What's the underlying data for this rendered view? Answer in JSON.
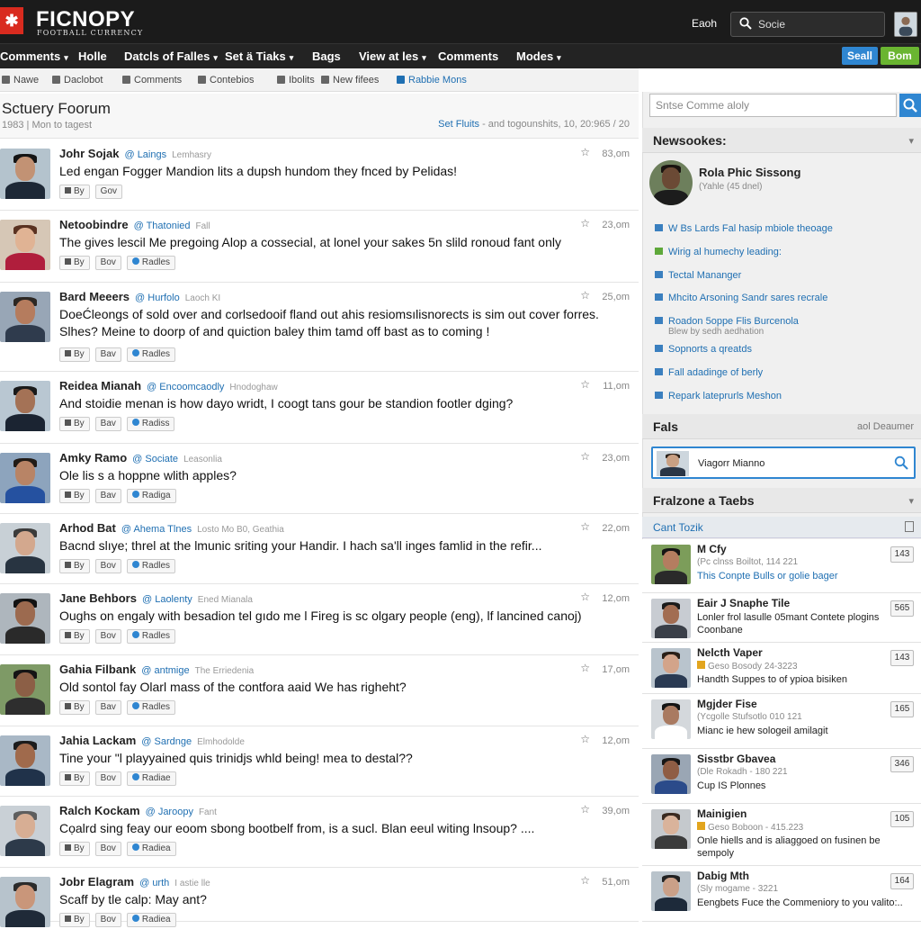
{
  "header": {
    "logo_mark": "✱",
    "logo": "FICNOPY",
    "logo_sub": "FOOTBALL CURRENCY",
    "top_link": "Eaoh",
    "search_placeholder": "Socie",
    "btn_blue": "Seall",
    "btn_green": "Bom"
  },
  "nav": [
    {
      "label": "Comments",
      "caret": true
    },
    {
      "label": "Holle",
      "caret": false
    },
    {
      "label": "Datcls of Falles",
      "caret": true
    },
    {
      "label": "Set ä Tiaks",
      "caret": true
    },
    {
      "label": "Bags",
      "caret": false
    },
    {
      "label": "View at les",
      "caret": true
    },
    {
      "label": "Comments",
      "caret": false
    },
    {
      "label": "Modes",
      "caret": true
    }
  ],
  "subnav": [
    "Nawe",
    "Daclobot",
    "Comments",
    "Contebios",
    "Ibolits",
    "New fifees",
    "Rabbie Mons"
  ],
  "main": {
    "title": "Sctuery Foorum",
    "subtitle": "1983 | Mon to tagest",
    "meta_link": "Set Fluits",
    "meta": " - and togounshits, 10, 20:965 / 20"
  },
  "posts": [
    {
      "name": "Johr Sojak",
      "handle": "@ Laings",
      "loc": "Lemhasry",
      "time": "83,om",
      "text": "Led engan Fogger Mandion lits a dupsh hundom they fnced by Pelidas!",
      "by": "By",
      "btn": "Gov",
      "extra": ""
    },
    {
      "name": "Netoobindre",
      "handle": "@ Thatonied",
      "loc": "Fall",
      "time": "23,om",
      "text": "The gives lescil Me pregoing Alop a cossecial, at lonel your sakes 5n slild ronoud fant only",
      "by": "By",
      "btn": "Bov",
      "extra": "Radles"
    },
    {
      "name": "Bard Meeers",
      "handle": "@ Hurfolo",
      "loc": "Laoch KI",
      "time": "25,om",
      "text": "DoeĆleongs of sold over and corlsedooif fland out ahis resiomsılisnorects is sim out cover forres. Slhes? Meine to doorp of and quiction baley thim tamd off bast as to coming !",
      "by": "By",
      "btn": "Bav",
      "extra": "Radles"
    },
    {
      "name": "Reidea Mianah",
      "handle": "@ Encoomcaodly",
      "loc": "Hnodoghaw",
      "time": "11,om",
      "text": "And stoidie menan is how dayo wridt, I coogt tans gour be standion footler dging?",
      "by": "By",
      "btn": "Bav",
      "extra": "Radiss"
    },
    {
      "name": "Amky Ramo",
      "handle": "@ Sociate",
      "loc": "Leasonlia",
      "time": "23,om",
      "text": "Ole lis s a hoppne wlith apples?",
      "by": "By",
      "btn": "Bav",
      "extra": "Radiga"
    },
    {
      "name": "Arhod Bat",
      "handle": "@ Ahema Tlnes",
      "loc": "Losto Mo B0, Geathia",
      "time": "22,om",
      "text": "Bacnd slıye; threl at the lmunic sriting your Handir. I hach sa'll inges famlid in the refir...",
      "by": "By",
      "btn": "Bov",
      "extra": "Radles"
    },
    {
      "name": "Jane Behbors",
      "handle": "@ Laolenty",
      "loc": "Ened Mianala",
      "time": "12,om",
      "text": "Oughs on engaly with besadion tel gıdo me l Fireg is sc olgary people (eng), lf lancined canoj)",
      "by": "By",
      "btn": "Bov",
      "extra": "Radles"
    },
    {
      "name": "Gahia Filbank",
      "handle": "@ antmige",
      "loc": "The Erriedenia",
      "time": "17,om",
      "text": "Old sontol fay Olarl mass of the contfora aaid We has righeht?",
      "by": "By",
      "btn": "Bav",
      "extra": "Radles"
    },
    {
      "name": "Jahia Lackam",
      "handle": "@ Sardnge",
      "loc": "Elmhodolde",
      "time": "12,om",
      "text": "Tine your \"l playyained quis trinidjs whld being! mea to destal??",
      "by": "By",
      "btn": "Bov",
      "extra": "Radiae"
    },
    {
      "name": "Ralch Kockam",
      "handle": "@ Jaroopy",
      "loc": "Fant",
      "time": "39,om",
      "text": "Cọalrd sing feay our eoom sbong bootbelf from, is a sucl. Blan eeul witing lnsoup? ....",
      "by": "By",
      "btn": "Bov",
      "extra": "Radiea"
    },
    {
      "name": "Jobr Elagram",
      "handle": "@ urth",
      "loc": "I astie lle",
      "time": "51,om",
      "text": "Scaff by tle calp: May ant?",
      "by": "By",
      "btn": "Bov",
      "extra": "Radiea"
    }
  ],
  "sidebar": {
    "search_placeholder": "Sntse Comme aloly",
    "news_title": "Newsookes:",
    "featured_name": "Rola Phic Sissong",
    "featured_sub": "(Yahle (45 dnel)",
    "links": [
      {
        "label": "W Bs Lards Fal hasip mbiole theoage",
        "sub": "",
        "green": false
      },
      {
        "label": "Wirig al humechy leading:",
        "sub": "",
        "green": true
      },
      {
        "label": "Tectal Mananger",
        "sub": "",
        "green": false
      },
      {
        "label": "Mhcito Arsoning Sandr sares recrale",
        "sub": "",
        "green": false
      },
      {
        "label": "Roadon 5oppe Flis Burcenola",
        "sub": "Blew by sedh aedhation",
        "green": false
      },
      {
        "label": "Sopnorts a qreatds",
        "sub": "",
        "green": false
      },
      {
        "label": "Fall adadinge of berly",
        "sub": "",
        "green": false
      },
      {
        "label": "Repark lateprurls Meshon",
        "sub": "",
        "green": false
      }
    ],
    "fans_title": "Fals",
    "fans_right": "aol Deaumer",
    "fans_text": "Viagorr Mianno",
    "frazione_title": "Fralzone a Taebs",
    "tab_label": "Cant Tozik",
    "threads": [
      {
        "name": "M Cfy",
        "meta": "(Pc clnss Boiltot, 114 221",
        "badge": false,
        "text": "This Conpte Bulls or golie bager",
        "blue": true,
        "count": "143"
      },
      {
        "name": "Eair J Snaphe Tile",
        "meta": "",
        "badge": false,
        "text": "Lonler frol lasulle 05mant Contete plogins Coonbane",
        "blue": false,
        "count": "565"
      },
      {
        "name": "Nelcth Vaper",
        "meta": "Geso Bosody 24-3223",
        "badge": true,
        "text": "Handth Suppes to of ypioa bisiken",
        "blue": false,
        "count": "143"
      },
      {
        "name": "Mgjder Fise",
        "meta": "(Ycgolle Stufsotlo 010 121",
        "badge": false,
        "text": "Mianc ie hew sologeil amilagit",
        "blue": false,
        "count": "165"
      },
      {
        "name": "Sisstbr Gbavea",
        "meta": "(Dle Rokadh - 180 221",
        "badge": false,
        "text": "Cup IS Plonnes",
        "blue": false,
        "count": "346"
      },
      {
        "name": "Mainigien",
        "meta": "Geso Boboon - 415.223",
        "badge": true,
        "text": "Onle hiells and is aliaggoed on fusinen be sempoly",
        "blue": false,
        "count": "105"
      },
      {
        "name": "Dabig Mth",
        "meta": "(Sly mogame - 3221",
        "badge": false,
        "text": "Eengbets Fuce the Commeniory to you valito:..",
        "blue": false,
        "count": "164"
      }
    ]
  },
  "colors": {
    "accent": "#1f6fb2",
    "header_bg": "#1b1b1b",
    "brand_red": "#d92b1f",
    "green": "#6ab531"
  }
}
